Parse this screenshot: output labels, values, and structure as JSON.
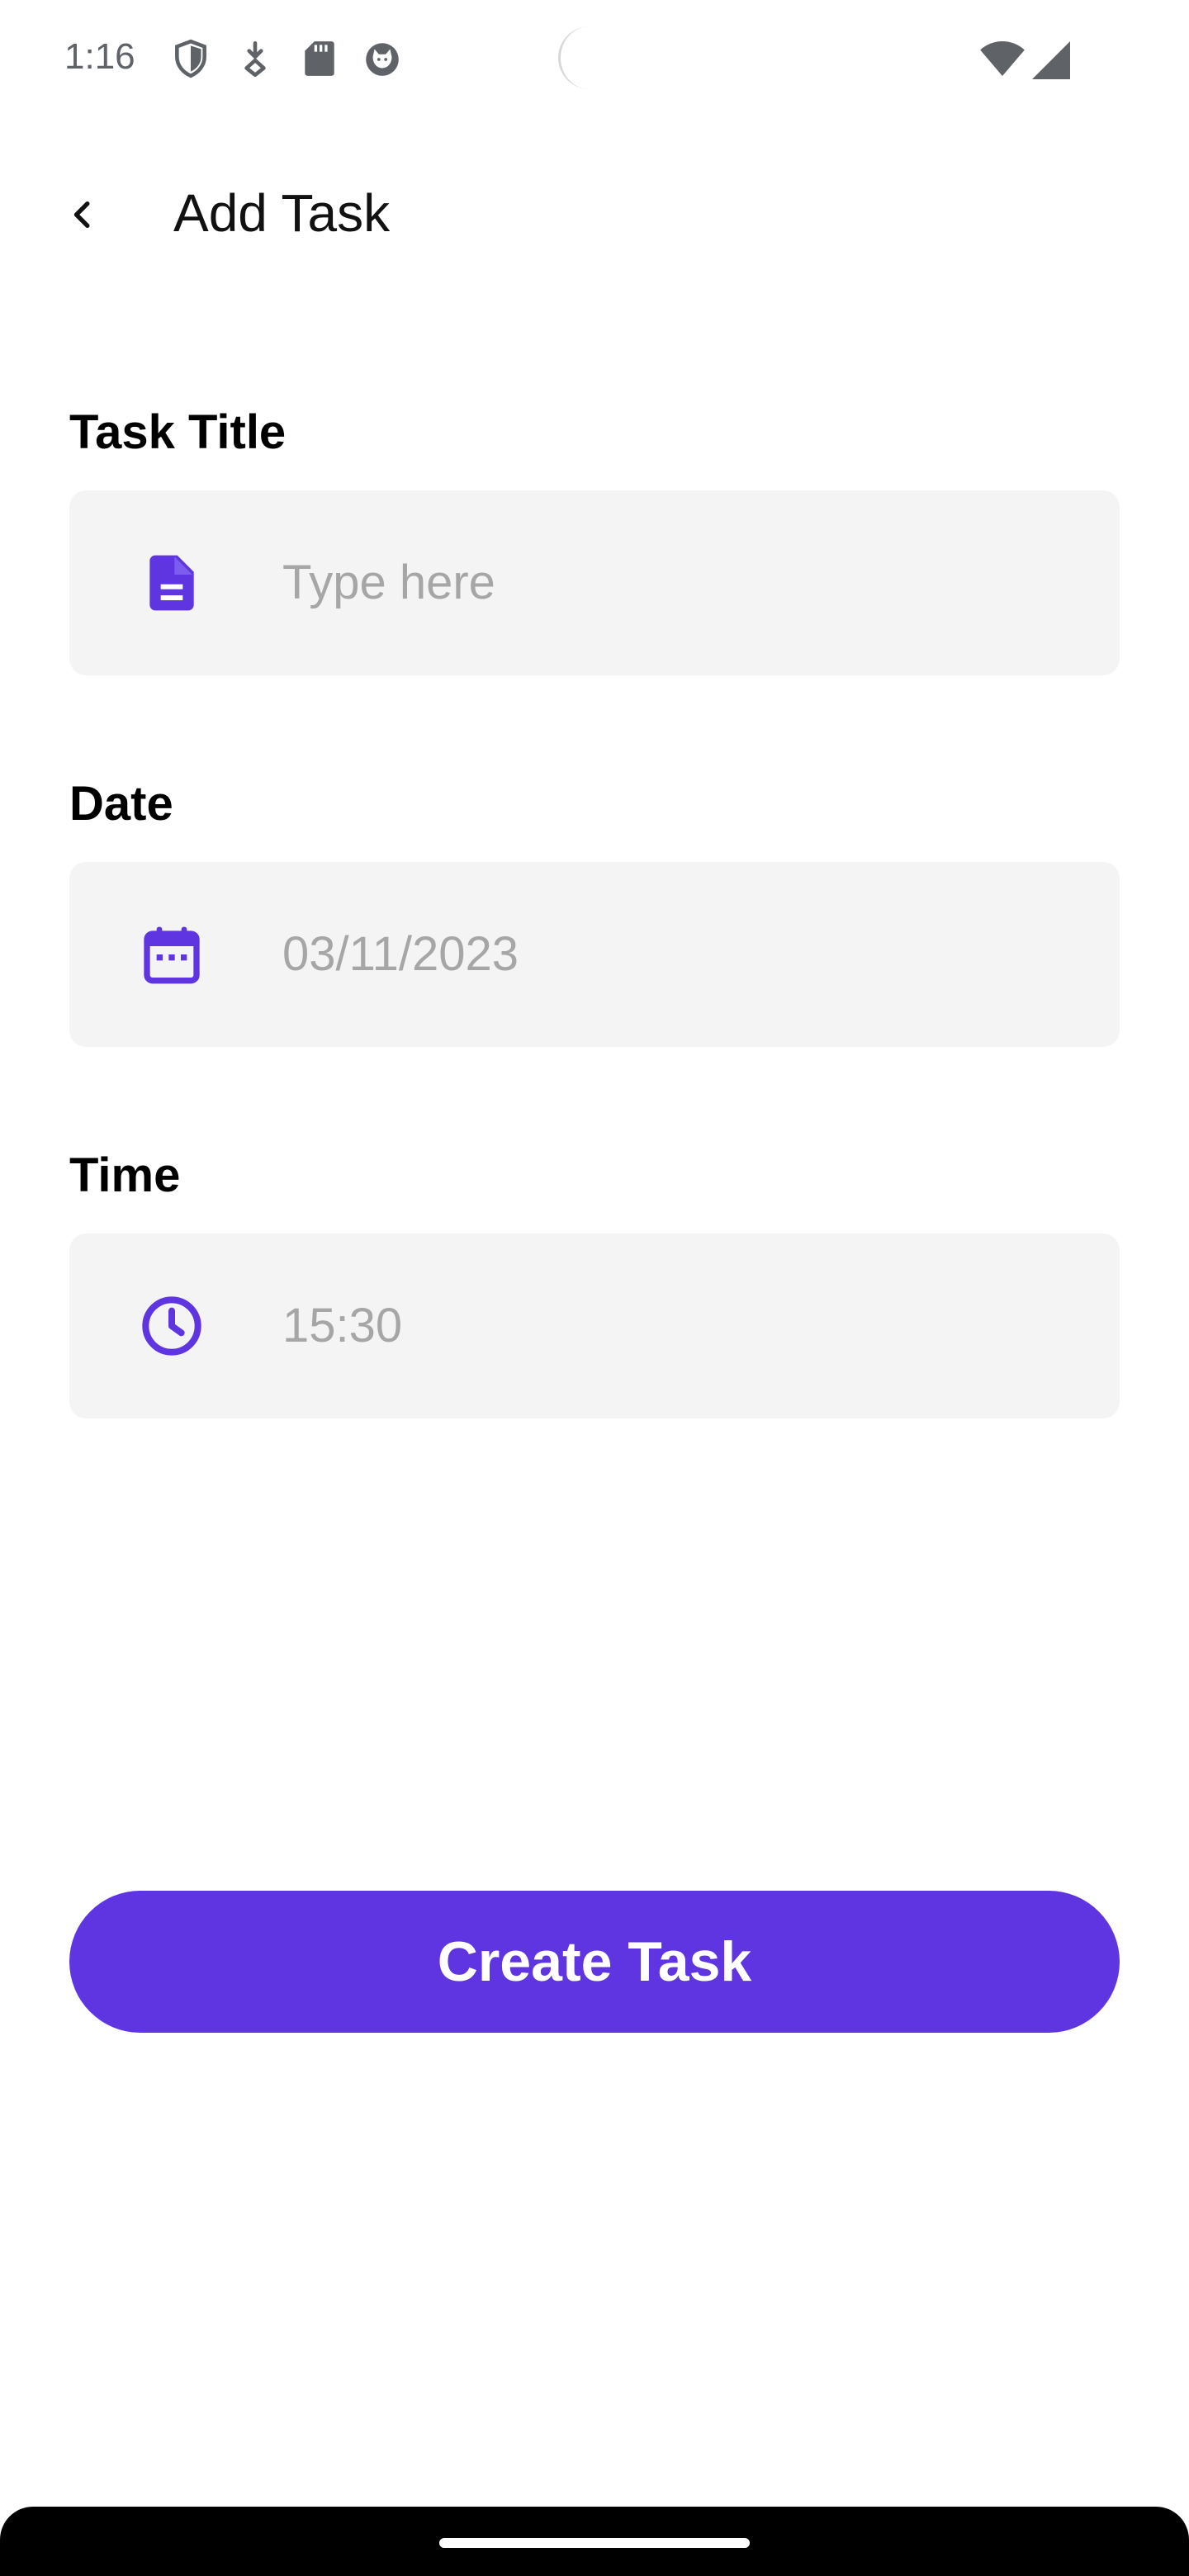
{
  "status_bar": {
    "time": "1:16",
    "icons": [
      "shield-icon",
      "download-icon",
      "sd-card-icon",
      "cat-icon",
      "wifi-icon",
      "cellular-signal-icon"
    ]
  },
  "header": {
    "title": "Add Task",
    "back_icon": "chevron-left-icon"
  },
  "form": {
    "task_title": {
      "label": "Task Title",
      "placeholder": "Type here",
      "value": "",
      "icon": "document-icon"
    },
    "date": {
      "label": "Date",
      "value": "03/11/2023",
      "icon": "calendar-icon"
    },
    "time": {
      "label": "Time",
      "value": "15:30",
      "icon": "clock-icon"
    }
  },
  "actions": {
    "create_label": "Create Task"
  },
  "colors": {
    "accent": "#5e35e0",
    "field_background": "#f4f4f4",
    "placeholder_text": "#a6a6a6"
  }
}
